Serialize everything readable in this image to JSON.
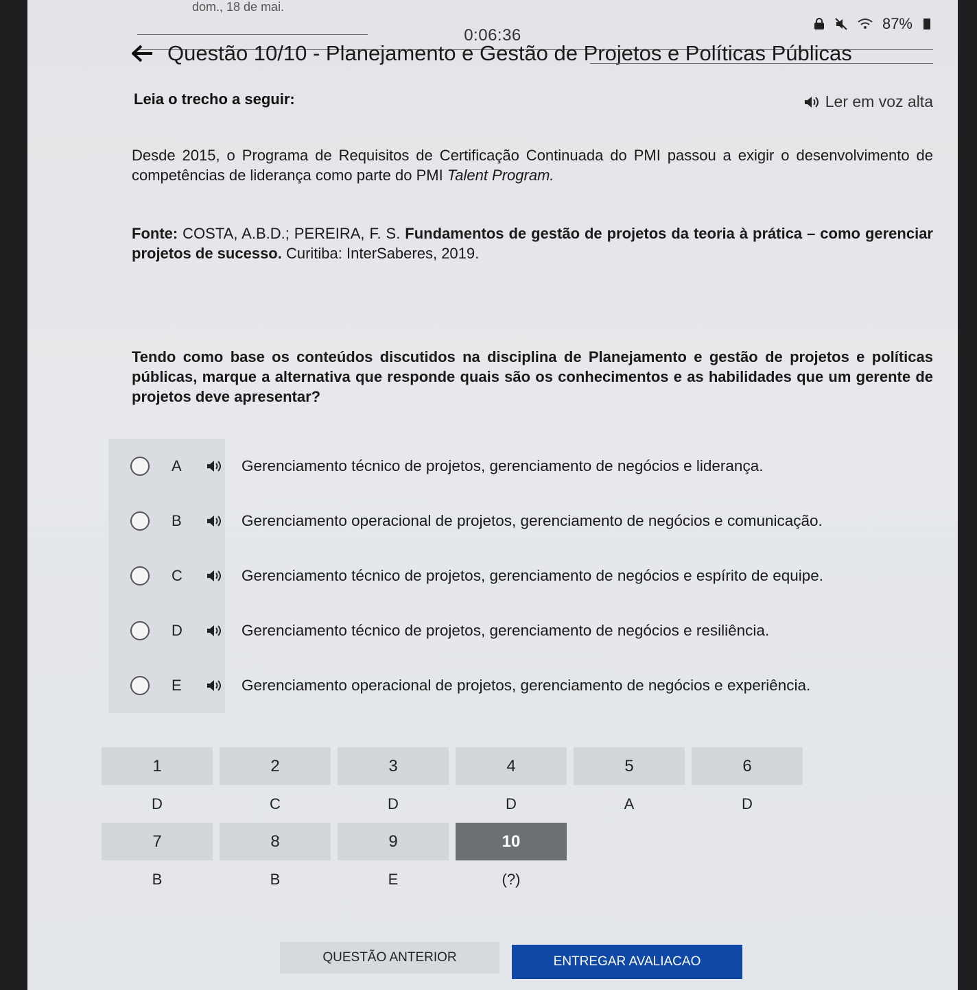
{
  "status": {
    "left_text": "dom., 18 de mai.",
    "battery": "87%"
  },
  "timer": "0:06:36",
  "title": "Questão 10/10 - Planejamento e Gestão de Projetos e Políticas Públicas",
  "intro": "Leia o trecho a seguir:",
  "read_aloud": "Ler em voz alta",
  "excerpt": {
    "p1_a": "Desde 2015, o Programa de Requisitos de Certificação Continuada do PMI passou a exigir o desenvolvimento de competências de liderança como parte do PMI ",
    "p1_italic": "Talent Program.",
    "source_label": "Fonte:",
    "source_authors": " COSTA, A.B.D.; PEREIRA, F. S. ",
    "source_title": "Fundamentos de gestão de projetos da teoria à prática – como gerenciar projetos de sucesso.",
    "source_pub": " Curitiba: InterSaberes, 2019."
  },
  "question": "Tendo como base os conteúdos discutidos na disciplina de Planejamento e gestão de projetos e políticas públicas, marque a alternativa que responde quais são os conhecimentos e as habilidades que um gerente de projetos deve apresentar?",
  "options": [
    {
      "letter": "A",
      "text": "Gerenciamento técnico de projetos, gerenciamento de negócios e liderança."
    },
    {
      "letter": "B",
      "text": "Gerenciamento operacional de projetos, gerenciamento de negócios e comunicação."
    },
    {
      "letter": "C",
      "text": "Gerenciamento técnico de projetos, gerenciamento de negócios e espírito de equipe."
    },
    {
      "letter": "D",
      "text": "Gerenciamento técnico de projetos, gerenciamento de negócios e resiliência."
    },
    {
      "letter": "E",
      "text": "Gerenciamento operacional de projetos, gerenciamento de negócios e experiência."
    }
  ],
  "navigator": [
    {
      "num": "1",
      "answer": "D"
    },
    {
      "num": "2",
      "answer": "C"
    },
    {
      "num": "3",
      "answer": "D"
    },
    {
      "num": "4",
      "answer": "D"
    },
    {
      "num": "5",
      "answer": "A"
    },
    {
      "num": "6",
      "answer": "D"
    },
    {
      "num": "7",
      "answer": "B"
    },
    {
      "num": "8",
      "answer": "B"
    },
    {
      "num": "9",
      "answer": "E"
    },
    {
      "num": "10",
      "answer": "(?)"
    }
  ],
  "buttons": {
    "previous": "QUESTÃO ANTERIOR",
    "submit": "ENTREGAR AVALIACAO"
  },
  "colors": {
    "submit_bg": "#1048a8",
    "current_cell_bg": "#6b7075"
  }
}
